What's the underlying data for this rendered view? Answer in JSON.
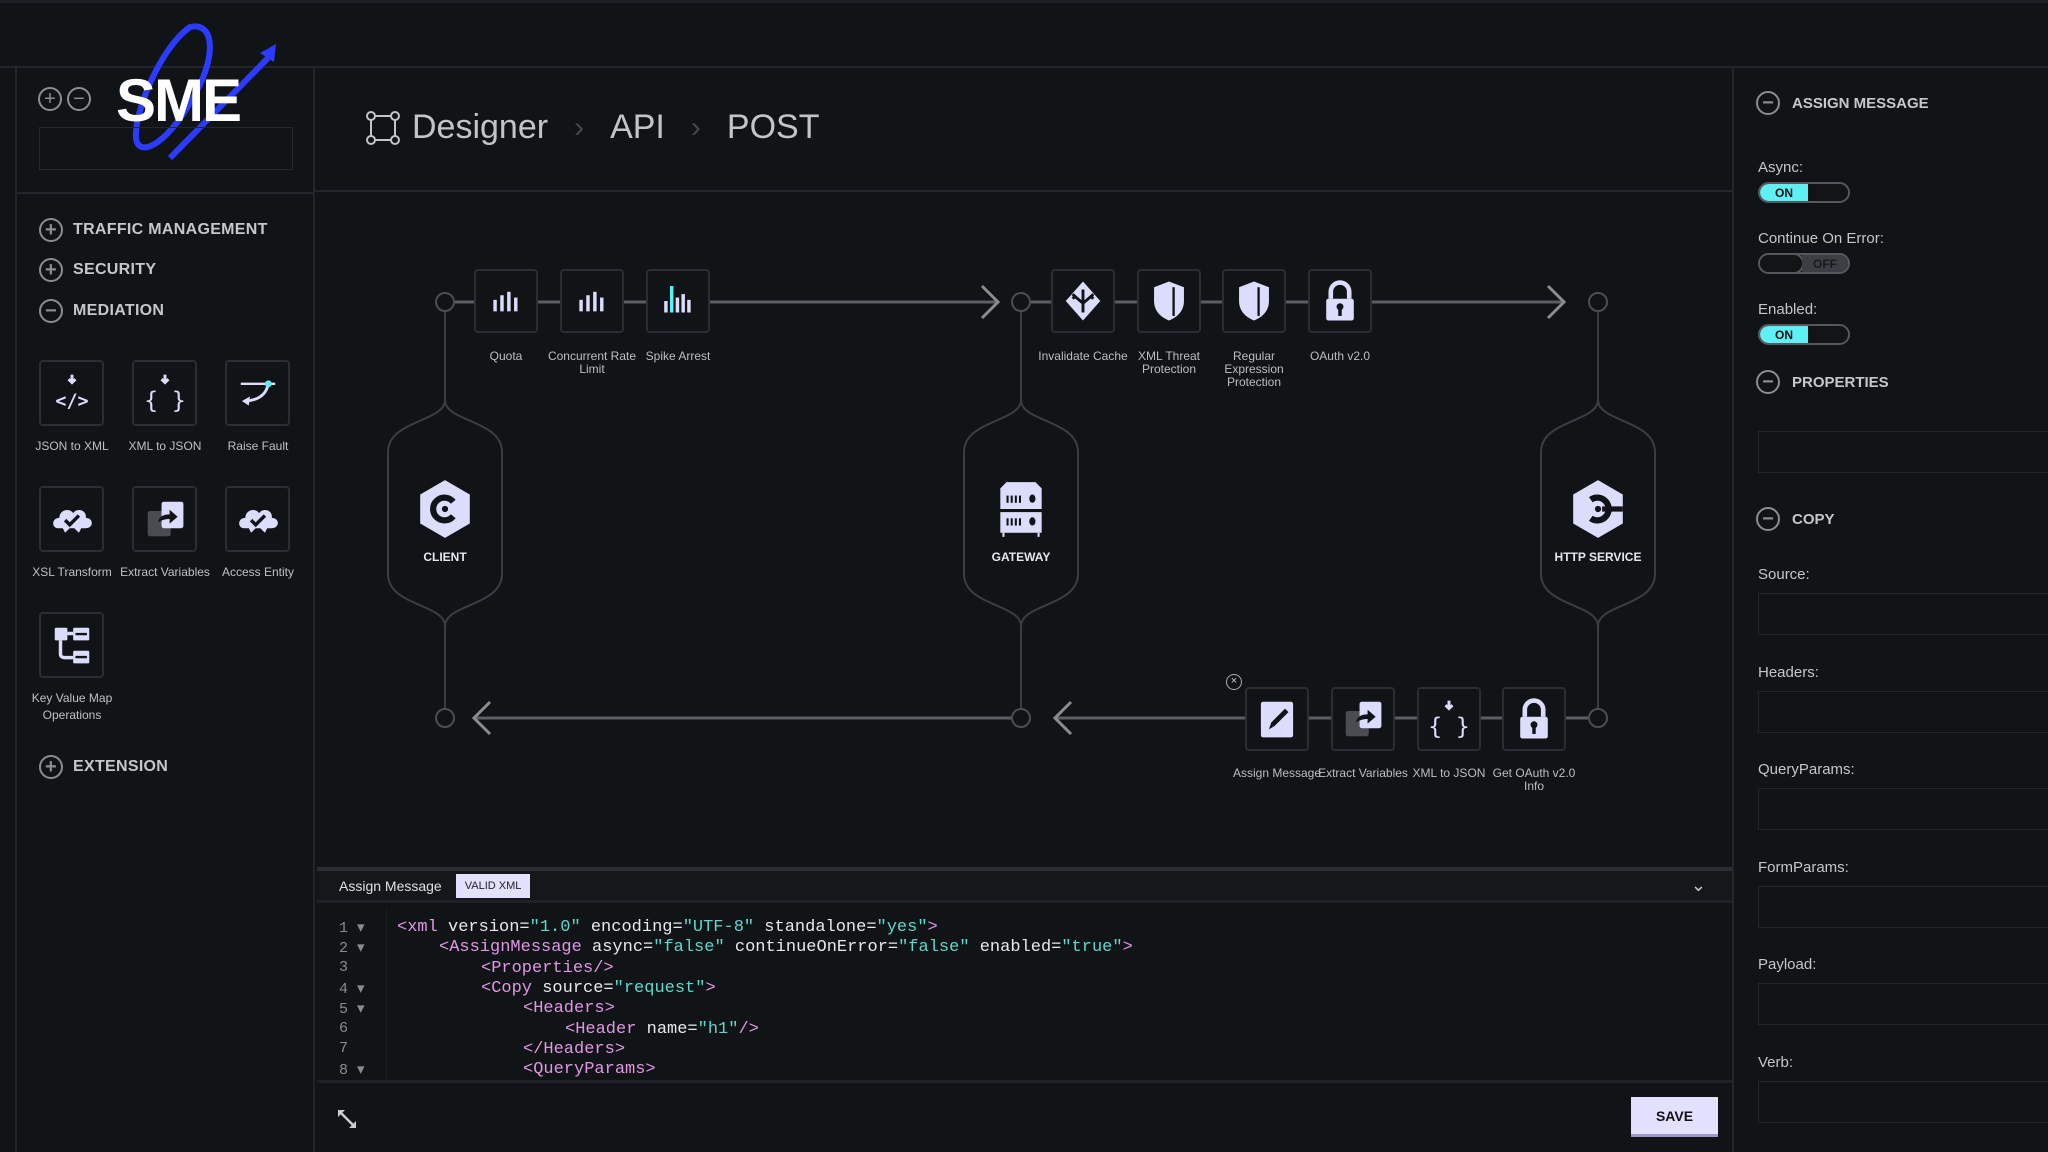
{
  "logo": {
    "text": "SME",
    "accent": "#2b3bff"
  },
  "breadcrumb": {
    "items": [
      "Designer",
      "API",
      "POST"
    ]
  },
  "sidebar": {
    "sections": [
      {
        "label": "TRAFFIC MANAGEMENT",
        "state": "collapsed"
      },
      {
        "label": "SECURITY",
        "state": "collapsed"
      },
      {
        "label": "MEDIATION",
        "state": "expanded"
      },
      {
        "label": "EXTENSION",
        "state": "collapsed"
      }
    ],
    "mediation_items": [
      {
        "label": "JSON to XML",
        "icon": "code-down-icon"
      },
      {
        "label": "XML to JSON",
        "icon": "braces-down-icon"
      },
      {
        "label": "Raise Fault",
        "icon": "raise-fault-icon"
      },
      {
        "label": "XSL Transform",
        "icon": "cloud-check-icon"
      },
      {
        "label": "Extract Variables",
        "icon": "extract-icon"
      },
      {
        "label": "Access Entity",
        "icon": "cloud-check-icon"
      },
      {
        "label": "Key Value Map Operations",
        "icon": "tree-icon"
      }
    ]
  },
  "flow": {
    "nodes": [
      {
        "label": "CLIENT",
        "icon": "client-hex-icon"
      },
      {
        "label": "GATEWAY",
        "icon": "server-icon"
      },
      {
        "label": "HTTP SERVICE",
        "icon": "service-hex-icon"
      }
    ],
    "request_client": [
      {
        "label": "Quota",
        "icon": "bars-icon"
      },
      {
        "label": "Concurrent Rate Limit",
        "icon": "bars-icon"
      },
      {
        "label": "Spike Arrest",
        "icon": "spike-bars-icon"
      }
    ],
    "request_gateway": [
      {
        "label": "Invalidate Cache",
        "icon": "diamond-arrows-icon"
      },
      {
        "label": "XML Threat Protection",
        "icon": "shield-icon"
      },
      {
        "label": "Regular Expression Protection",
        "icon": "shield-icon"
      },
      {
        "label": "OAuth v2.0",
        "icon": "lock-icon"
      }
    ],
    "response": [
      {
        "label": "Assign Message",
        "icon": "pencil-icon"
      },
      {
        "label": "Extract Variables",
        "icon": "extract-icon"
      },
      {
        "label": "XML to JSON",
        "icon": "braces-down-icon"
      },
      {
        "label": "Get OAuth v2.0 Info",
        "icon": "lock-icon"
      }
    ]
  },
  "editor": {
    "tab_label": "Assign Message",
    "badge": "VALID XML",
    "save_label": "SAVE",
    "lines": [
      {
        "n": "1",
        "fold": true,
        "indent": 0,
        "tokens": [
          [
            "tag",
            "<xml "
          ],
          [
            "atr",
            "version="
          ],
          [
            "val",
            "\"1.0\""
          ],
          [
            "atr",
            " encoding="
          ],
          [
            "val",
            "\"UTF-8\""
          ],
          [
            "atr",
            " standalone="
          ],
          [
            "val",
            "\"yes\""
          ],
          [
            "tag",
            ">"
          ]
        ]
      },
      {
        "n": "2",
        "fold": true,
        "indent": 1,
        "tokens": [
          [
            "tag",
            "<AssignMessage "
          ],
          [
            "atr",
            "async="
          ],
          [
            "val",
            "\"false\""
          ],
          [
            "atr",
            " continueOnError="
          ],
          [
            "val",
            "\"false\""
          ],
          [
            "atr",
            " enabled="
          ],
          [
            "val",
            "\"true\""
          ],
          [
            "tag",
            ">"
          ]
        ]
      },
      {
        "n": "3",
        "fold": false,
        "indent": 2,
        "tokens": [
          [
            "tag",
            "<Properties/>"
          ]
        ]
      },
      {
        "n": "4",
        "fold": true,
        "indent": 2,
        "tokens": [
          [
            "tag",
            "<Copy "
          ],
          [
            "atr",
            "source="
          ],
          [
            "val",
            "\"request\""
          ],
          [
            "tag",
            ">"
          ]
        ]
      },
      {
        "n": "5",
        "fold": true,
        "indent": 3,
        "tokens": [
          [
            "tag",
            "<Headers>"
          ]
        ]
      },
      {
        "n": "6",
        "fold": false,
        "indent": 4,
        "tokens": [
          [
            "tag",
            "<Header "
          ],
          [
            "atr",
            "name="
          ],
          [
            "val",
            "\"h1\""
          ],
          [
            "tag",
            "/>"
          ]
        ]
      },
      {
        "n": "7",
        "fold": false,
        "indent": 3,
        "tokens": [
          [
            "tag",
            "</Headers>"
          ]
        ]
      },
      {
        "n": "8",
        "fold": true,
        "indent": 3,
        "tokens": [
          [
            "tag",
            "<QueryParams>"
          ]
        ]
      }
    ]
  },
  "properties_panel": {
    "assign_title": "ASSIGN MESSAGE",
    "toggles": [
      {
        "label": "Async:",
        "on": true,
        "text": "ON"
      },
      {
        "label": "Continue On Error:",
        "on": false,
        "text": "OFF"
      },
      {
        "label": "Enabled:",
        "on": true,
        "text": "ON"
      }
    ],
    "properties_title": "PROPERTIES",
    "copy_title": "COPY",
    "copy_fields": [
      {
        "label": "Source:",
        "value": ""
      },
      {
        "label": "Headers:",
        "value": ""
      },
      {
        "label": "QueryParams:",
        "value": ""
      },
      {
        "label": "FormParams:",
        "value": ""
      },
      {
        "label": "Payload:",
        "value": ""
      },
      {
        "label": "Verb:",
        "value": ""
      }
    ]
  },
  "colors": {
    "background": "#111417",
    "icon": "#dcdcfc",
    "accent_cyan": "#5ff0f5",
    "tag": "#e196e4",
    "value": "#5fd8cb"
  }
}
